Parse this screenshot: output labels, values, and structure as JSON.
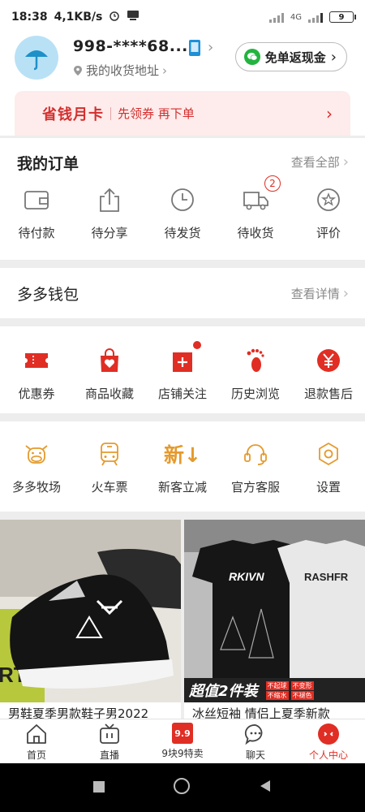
{
  "status_bar": {
    "time": "18:38",
    "speed": "4,1KB/s",
    "network": "4G",
    "battery": "9"
  },
  "header": {
    "username": "998-****68...",
    "address_label": "我的收货地址",
    "cashback_button": "免单返现金"
  },
  "monthly_card": {
    "title": "省钱月卡",
    "subtitle": "先领券 再下单"
  },
  "orders": {
    "title": "我的订单",
    "view_all": "查看全部",
    "items": [
      {
        "label": "待付款",
        "icon": "wallet-icon"
      },
      {
        "label": "待分享",
        "icon": "share-icon"
      },
      {
        "label": "待发货",
        "icon": "clock-icon"
      },
      {
        "label": "待收货",
        "icon": "truck-icon",
        "badge": "2"
      },
      {
        "label": "评价",
        "icon": "star-review-icon"
      }
    ]
  },
  "wallet": {
    "title": "多多钱包",
    "view_details": "查看详情"
  },
  "services": {
    "items": [
      {
        "label": "优惠券",
        "icon": "coupon-icon"
      },
      {
        "label": "商品收藏",
        "icon": "favorites-bag-icon"
      },
      {
        "label": "店铺关注",
        "icon": "store-follow-icon"
      },
      {
        "label": "历史浏览",
        "icon": "footprint-icon"
      },
      {
        "label": "退款售后",
        "icon": "refund-icon"
      }
    ]
  },
  "tools": {
    "items": [
      {
        "label": "多多牧场",
        "icon": "cow-icon"
      },
      {
        "label": "火车票",
        "icon": "train-icon"
      },
      {
        "label": "新客立减",
        "icon": "new-customer-icon",
        "icon_text": "新↓"
      },
      {
        "label": "官方客服",
        "icon": "headset-icon"
      },
      {
        "label": "设置",
        "icon": "settings-icon"
      }
    ]
  },
  "products": [
    {
      "title": "男鞋夏季男款鞋子男2022",
      "image_text": "RT"
    },
    {
      "title": "冰丝短袖 情侣上夏季新款",
      "promo": "超值2件装",
      "tags": [
        "不起球",
        "不变形",
        "不缩水",
        "不褪色"
      ],
      "shirt_text": [
        "RKIVN",
        "RASHFR"
      ]
    }
  ],
  "tabbar": [
    {
      "label": "首页",
      "icon": "home-icon"
    },
    {
      "label": "直播",
      "icon": "live-tv-icon"
    },
    {
      "label": "9块9特卖",
      "icon": "sale-99-icon",
      "icon_text": "9.9"
    },
    {
      "label": "聊天",
      "icon": "chat-icon"
    },
    {
      "label": "个人中心",
      "icon": "profile-icon",
      "active": true
    }
  ],
  "colors": {
    "brand_red": "#e02e24",
    "orange": "#e59a2c",
    "wechat_green": "#23b33f"
  }
}
